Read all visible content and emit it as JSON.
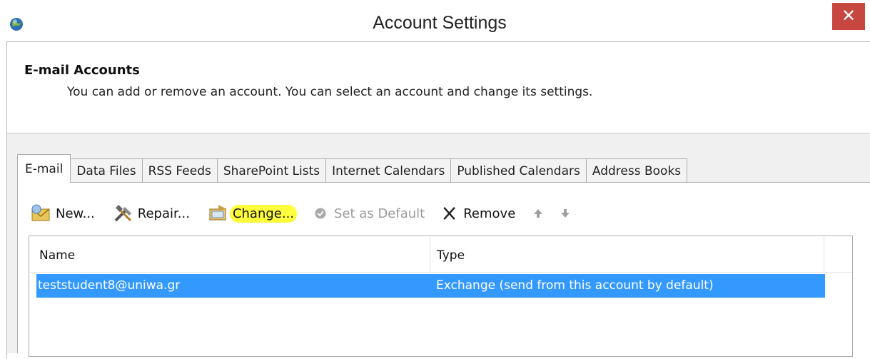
{
  "window": {
    "title": "Account Settings",
    "close_glyph": "✕"
  },
  "header": {
    "title": "E-mail Accounts",
    "description": "You can add or remove an account. You can select an account and change its settings."
  },
  "tabs": [
    {
      "label": "E-mail",
      "active": true
    },
    {
      "label": "Data Files"
    },
    {
      "label": "RSS Feeds"
    },
    {
      "label": "SharePoint Lists"
    },
    {
      "label": "Internet Calendars"
    },
    {
      "label": "Published Calendars"
    },
    {
      "label": "Address Books"
    }
  ],
  "toolbar": {
    "new_label": "New...",
    "repair_label": "Repair...",
    "change_label": "Change...",
    "set_default_label": "Set as Default",
    "remove_label": "Remove"
  },
  "table": {
    "columns": [
      "Name",
      "Type"
    ],
    "rows": [
      {
        "name": "teststudent8@uniwa.gr",
        "type": "Exchange (send from this account by default)"
      }
    ]
  },
  "colors": {
    "selection": "#3399ff",
    "close": "#c7463f",
    "highlight": "#ffff3c"
  }
}
